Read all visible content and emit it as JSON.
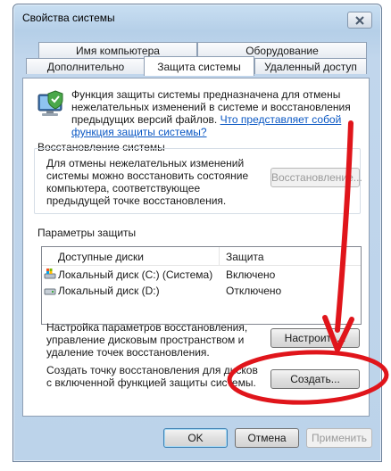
{
  "window": {
    "title": "Свойства системы"
  },
  "tabs": {
    "row1": [
      "Имя компьютера",
      "Оборудование"
    ],
    "row2": [
      "Дополнительно",
      "Защита системы",
      "Удаленный доступ"
    ],
    "active": "Защита системы"
  },
  "intro": {
    "text": "Функция защиты системы предназначена для отмены нежелательных изменений в системе и восстановления предыдущих версий файлов.",
    "link": "Что представляет собой функция защиты системы?",
    "icon": "shield-computer-icon"
  },
  "restore": {
    "heading": "Восстановление системы",
    "text": "Для отмены нежелательных изменений системы можно восстановить состояние компьютера, соответствующее предыдущей точке восстановления.",
    "button": "Восстановление..."
  },
  "protection": {
    "heading": "Параметры защиты",
    "columns": [
      "Доступные диски",
      "Защита"
    ],
    "rows": [
      {
        "disk": "Локальный диск (C:) (Система)",
        "status": "Включено",
        "icon": "system-drive-icon"
      },
      {
        "disk": "Локальный диск (D:)",
        "status": "Отключено",
        "icon": "drive-icon"
      }
    ]
  },
  "configure": {
    "text": "Настройка параметров восстановления, управление дисковым пространством и удаление точек восстановления.",
    "button": "Настроить..."
  },
  "create": {
    "text": "Создать точку восстановления для дисков с включенной функцией защиты системы.",
    "button": "Создать..."
  },
  "footer": {
    "ok": "OK",
    "cancel": "Отмена",
    "apply": "Применить"
  },
  "colors": {
    "annotation": "#e0151b",
    "link": "#0b58c4",
    "window_frame": "#b5cfe8"
  }
}
